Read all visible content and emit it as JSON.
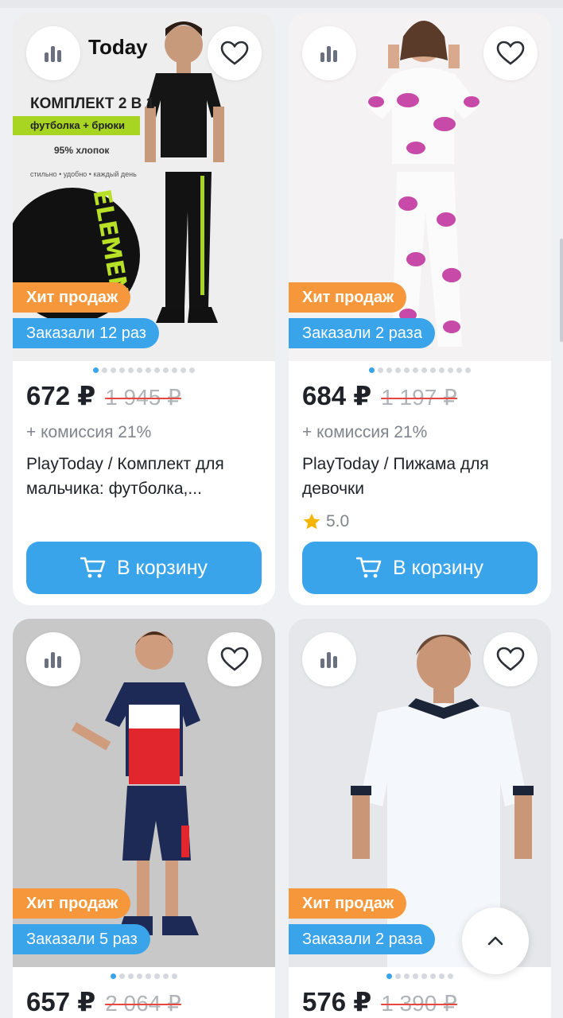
{
  "products": [
    {
      "badge_hit": "Хит продаж",
      "badge_orders": "Заказали 12 раз",
      "price": "672 ₽",
      "old_price": "1 945 ₽",
      "commission": "+ комиссия 21%",
      "title": "PlayToday / Комплект для мальчика: футболка,...",
      "rating": "",
      "cart_label": "В корзину",
      "photo_texts": {
        "brand": "Today",
        "set": "КОМПЛЕКТ 2 В 1",
        "items": "футболка + брюки",
        "cotton": "95% хлопок",
        "tagline": "стильно • удобно • каждый день"
      },
      "slider_total": 12,
      "slider_active": 0
    },
    {
      "badge_hit": "Хит продаж",
      "badge_orders": "Заказали 2 раза",
      "price": "684 ₽",
      "old_price": "1 197 ₽",
      "commission": "+ комиссия 21%",
      "title": "PlayToday / Пижама для девочки",
      "rating": "5.0",
      "cart_label": "В корзину",
      "slider_total": 12,
      "slider_active": 0
    },
    {
      "badge_hit": "Хит продаж",
      "badge_orders": "Заказали 5 раз",
      "price": "657 ₽",
      "old_price": "2 064 ₽",
      "slider_total": 8,
      "slider_active": 0
    },
    {
      "badge_hit": "Хит продаж",
      "badge_orders": "Заказали 2 раза",
      "price": "576 ₽",
      "old_price": "1 390 ₽",
      "slider_total": 8,
      "slider_active": 0
    }
  ],
  "icons": {
    "stats": "bar-chart-icon",
    "favorite": "heart-icon",
    "cart": "cart-icon",
    "star": "star-icon",
    "scroll_up": "chevron-up-icon"
  },
  "colors": {
    "accent": "#3aa4ea",
    "hit_badge": "#f6973b",
    "price_text": "#1f2228",
    "strike": "#e8473f",
    "star": "#f7b500"
  }
}
